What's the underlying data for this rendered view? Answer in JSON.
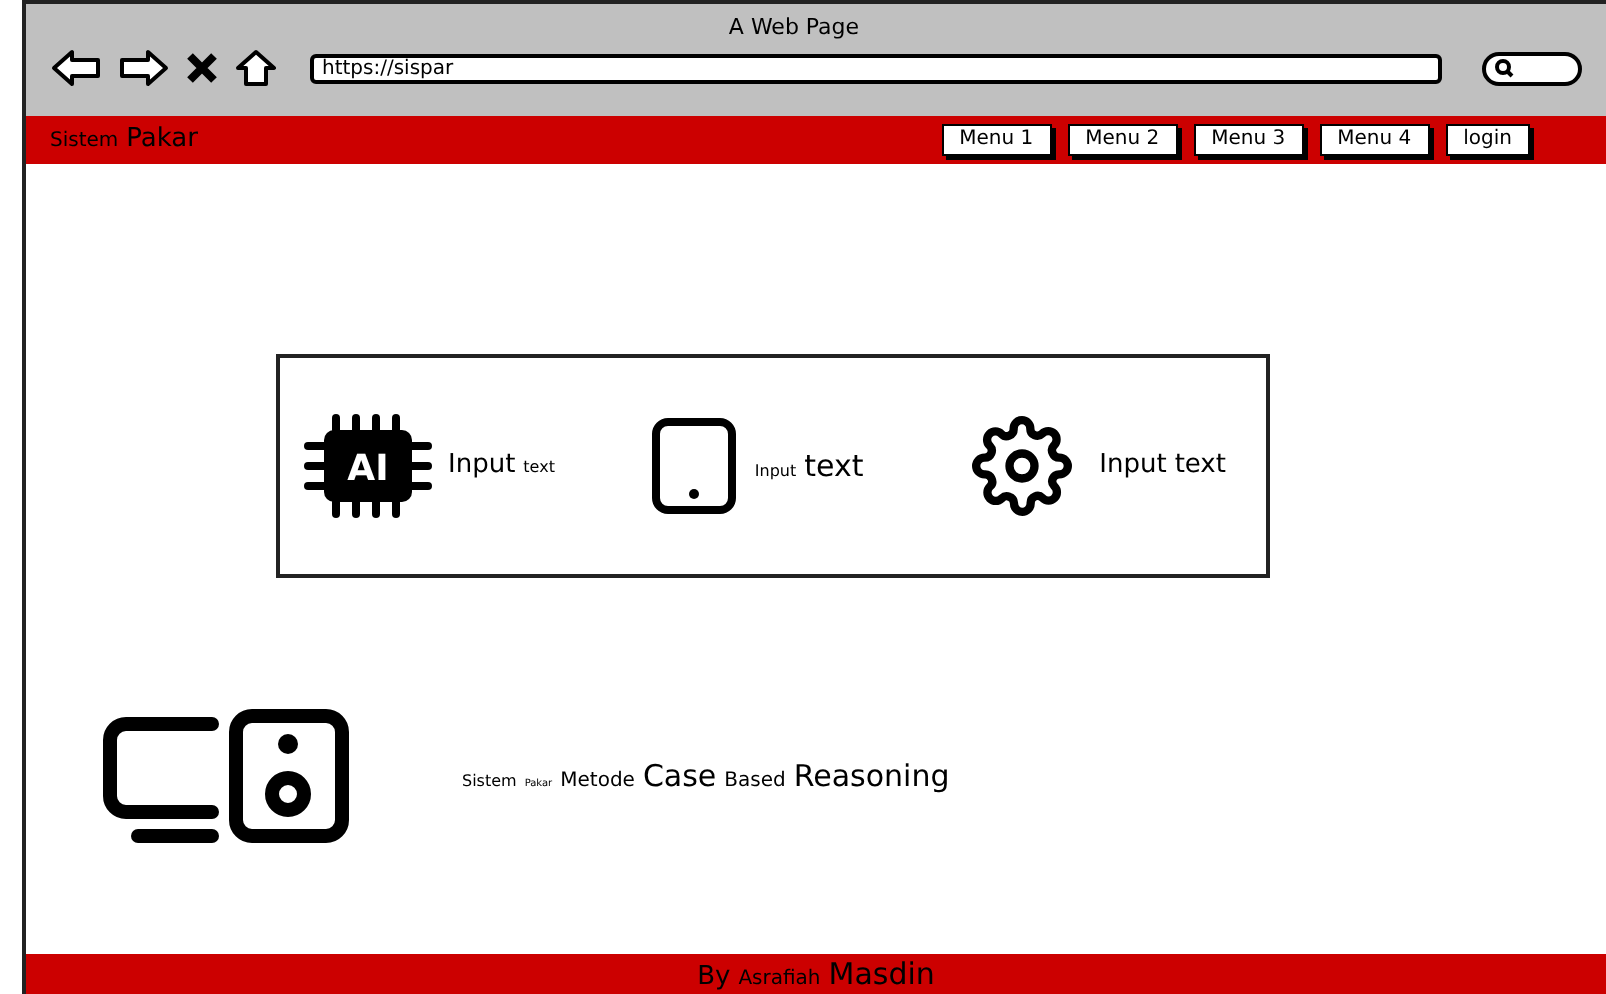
{
  "window": {
    "title": "A Web Page",
    "url": "https://sispar"
  },
  "navbar": {
    "brand": [
      {
        "text": "Sistem",
        "kind": "small"
      },
      {
        "text": "Pakar",
        "kind": "medium"
      }
    ],
    "menu": [
      "Menu 1",
      "Menu 2",
      "Menu 3",
      "Menu 4",
      "login"
    ]
  },
  "feature_panel": {
    "items": [
      {
        "kind": "chip",
        "icon_text": "AI",
        "words": [
          {
            "text": "Input",
            "kind": "medium"
          },
          {
            "text": "text",
            "kind": "tiny"
          }
        ]
      },
      {
        "kind": "tablet",
        "words": [
          {
            "text": "Input",
            "kind": "tiny"
          },
          {
            "text": "text",
            "kind": "large"
          }
        ]
      },
      {
        "kind": "gear",
        "words": [
          {
            "text": "Input",
            "kind": "medium"
          },
          {
            "text": "text",
            "kind": "medium"
          }
        ]
      }
    ]
  },
  "tagline": [
    {
      "text": "Sistem",
      "kind": "tiny"
    },
    {
      "text": "Pakar",
      "kind": "micro"
    },
    {
      "text": "Metode",
      "kind": "small"
    },
    {
      "text": "Case",
      "kind": "large"
    },
    {
      "text": "Based",
      "kind": "small"
    },
    {
      "text": "Reasoning",
      "kind": "large"
    }
  ],
  "footer": [
    {
      "text": "By",
      "kind": "medium"
    },
    {
      "text": "Asrafiah",
      "kind": "small"
    },
    {
      "text": "Masdin",
      "kind": "large"
    }
  ]
}
